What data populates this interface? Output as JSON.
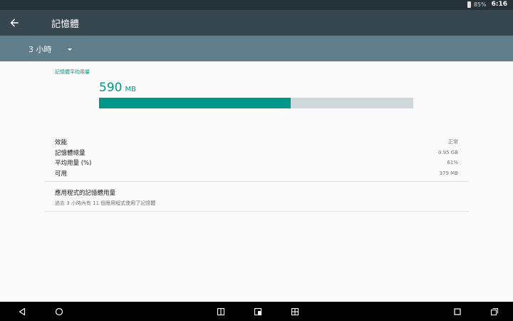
{
  "status_bar": {
    "battery": "85%",
    "time": "6:16"
  },
  "app_bar": {
    "title": "記憶體"
  },
  "filter": {
    "selected": "3 小時"
  },
  "memory": {
    "section_label": "記憶體平均用量",
    "average_number": "590",
    "average_unit": "MB",
    "usage_fraction": 0.61
  },
  "stats": [
    {
      "label": "效能",
      "value": "正常"
    },
    {
      "label": "記憶體總量",
      "value": "0.95 GB"
    },
    {
      "label": "平均用量 (%)",
      "value": "61%"
    },
    {
      "label": "可用",
      "value": "379 MB"
    }
  ],
  "apps_usage": {
    "title": "應用程式的記憶體用量",
    "summary": "過去 3 小時內有 11 個應用程式使用了記憶體"
  },
  "icons": {
    "back": "arrow-back-icon",
    "dropdown": "dropdown-arrow-icon",
    "nav": [
      "back-triangle-icon",
      "home-circle-icon",
      "split-screen-icon",
      "window-icon",
      "grid-icon",
      "overview-square-icon",
      "recents-icon"
    ]
  },
  "colors": {
    "accent": "#009688",
    "app_bar": "#37474f",
    "filter_bar": "#607d8b",
    "track": "#cfd8dc"
  }
}
